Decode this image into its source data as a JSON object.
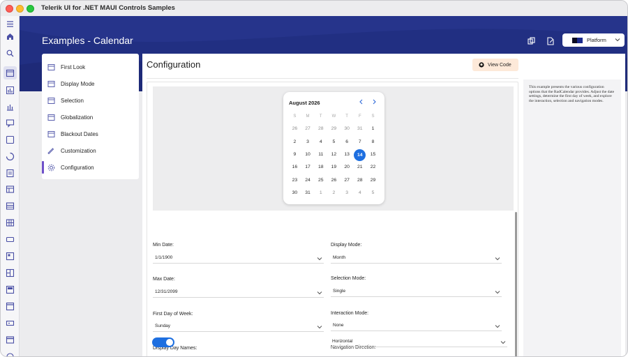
{
  "window": {
    "title": "Telerik UI for .NET MAUI Controls Samples"
  },
  "rail": {
    "icons": [
      "menu-icon",
      "home-icon",
      "search-icon",
      "calendar-icon",
      "bar-chart-icon",
      "column-chart-icon",
      "chat-icon",
      "checkbox-icon",
      "loader-icon",
      "document-icon",
      "table-icon",
      "list-icon",
      "grid-icon",
      "input-icon",
      "form-icon",
      "layout-icon",
      "panel-icon",
      "window-icon",
      "textbox-icon",
      "toolbar-icon",
      "more-icon"
    ]
  },
  "header": {
    "title": "Examples - Calendar",
    "platform_label": "Platform"
  },
  "nav": {
    "items": [
      {
        "label": "First Look",
        "icon": "calendar-icon"
      },
      {
        "label": "Display Mode",
        "icon": "calendar-icon"
      },
      {
        "label": "Selection",
        "icon": "calendar-icon"
      },
      {
        "label": "Globalization",
        "icon": "calendar-icon"
      },
      {
        "label": "Blackout Dates",
        "icon": "calendar-icon"
      },
      {
        "label": "Customization",
        "icon": "brush-icon"
      },
      {
        "label": "Configuration",
        "icon": "gear-icon"
      }
    ],
    "selected": "Configuration"
  },
  "main": {
    "title": "Configuration",
    "view_code_label": "View Code"
  },
  "calendar": {
    "month_label": "August 2026",
    "weekdays": [
      "S",
      "M",
      "T",
      "W",
      "T",
      "F",
      "S"
    ],
    "weeks": [
      [
        "26",
        "27",
        "28",
        "29",
        "30",
        "31",
        "1"
      ],
      [
        "2",
        "3",
        "4",
        "5",
        "6",
        "7",
        "8"
      ],
      [
        "9",
        "10",
        "11",
        "12",
        "13",
        "14",
        "15"
      ],
      [
        "16",
        "17",
        "18",
        "19",
        "20",
        "21",
        "22"
      ],
      [
        "23",
        "24",
        "25",
        "26",
        "27",
        "28",
        "29"
      ],
      [
        "30",
        "31",
        "1",
        "2",
        "3",
        "4",
        "5"
      ]
    ],
    "today": "14"
  },
  "form": {
    "min_date": {
      "label": "Min Date:",
      "value": "1/1/1900"
    },
    "max_date": {
      "label": "Max Date:",
      "value": "12/31/2099"
    },
    "first_day": {
      "label": "First Day of Week:",
      "value": "Sunday"
    },
    "day_names": {
      "label": "Display Day Names:",
      "value": true
    },
    "display_mode": {
      "label": "Display Mode:",
      "value": "Month"
    },
    "selection_mode": {
      "label": "Selection Mode:",
      "value": "Single"
    },
    "interaction_mode": {
      "label": "Interaction Mode:",
      "value": "None"
    },
    "navigation_direction": {
      "label": "Navigation Direction:",
      "value": "Horizontal"
    }
  },
  "description": "This example presents the various configuration options that the RadCalendar provides. Adjust the date settings, determine the first day of week, and explore the interaction, selection and navigation modes.",
  "colors": {
    "accent": "#1e6fe0",
    "hero": "#1e2a78",
    "nav_indicator": "#6e50c9",
    "view_code_bg": "#fde9d9"
  }
}
